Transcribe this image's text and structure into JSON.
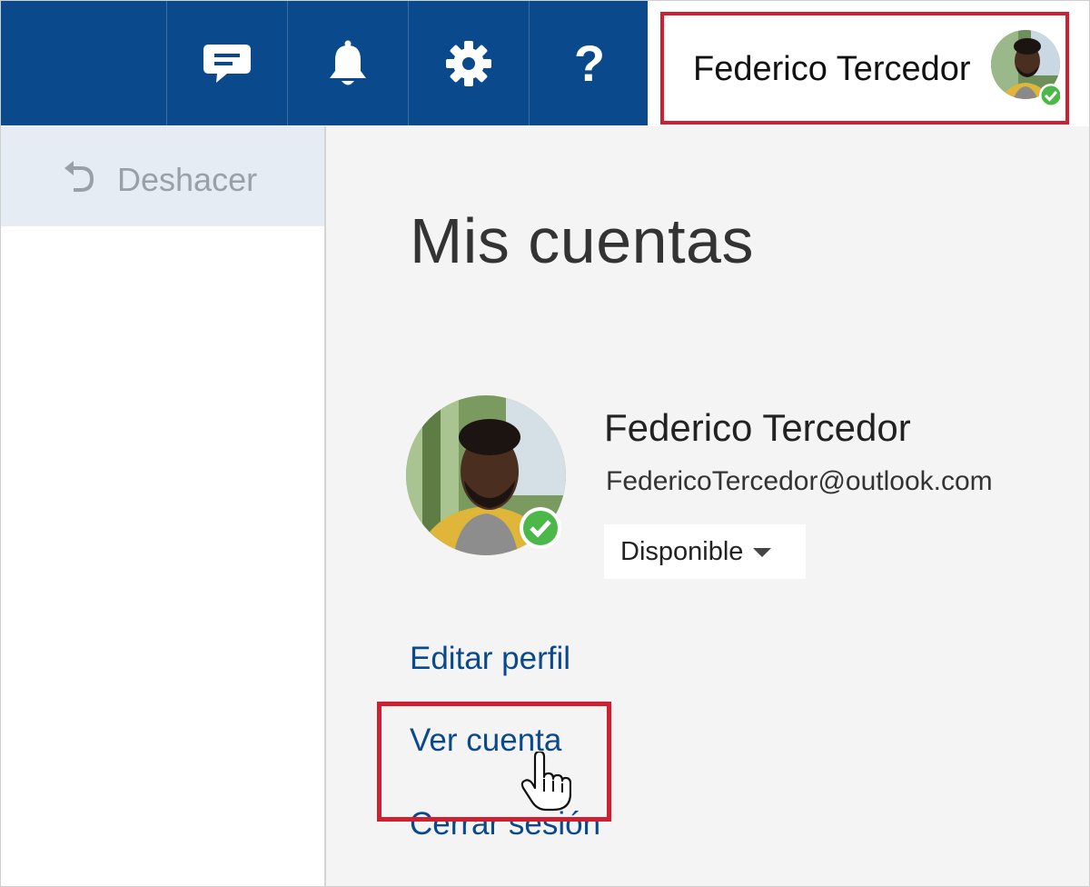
{
  "topbar": {
    "feedback_icon": "chat-bubble-icon",
    "notifications_icon": "bell-icon",
    "settings_icon": "gear-icon",
    "help_label": "?"
  },
  "user": {
    "name": "Federico Tercedor",
    "email": "FedericoTercedor@outlook.com",
    "status": "Disponible"
  },
  "left_pane": {
    "undo_label": "Deshacer"
  },
  "account_panel": {
    "title": "Mis cuentas",
    "links": {
      "edit_profile": "Editar perfil",
      "view_account": "Ver cuenta",
      "sign_out": "Cerrar sesión"
    }
  },
  "colors": {
    "topbar": "#0a4a8c",
    "link": "#0a4a8c",
    "highlight": "#d0202f",
    "presence": "#4cb849"
  }
}
